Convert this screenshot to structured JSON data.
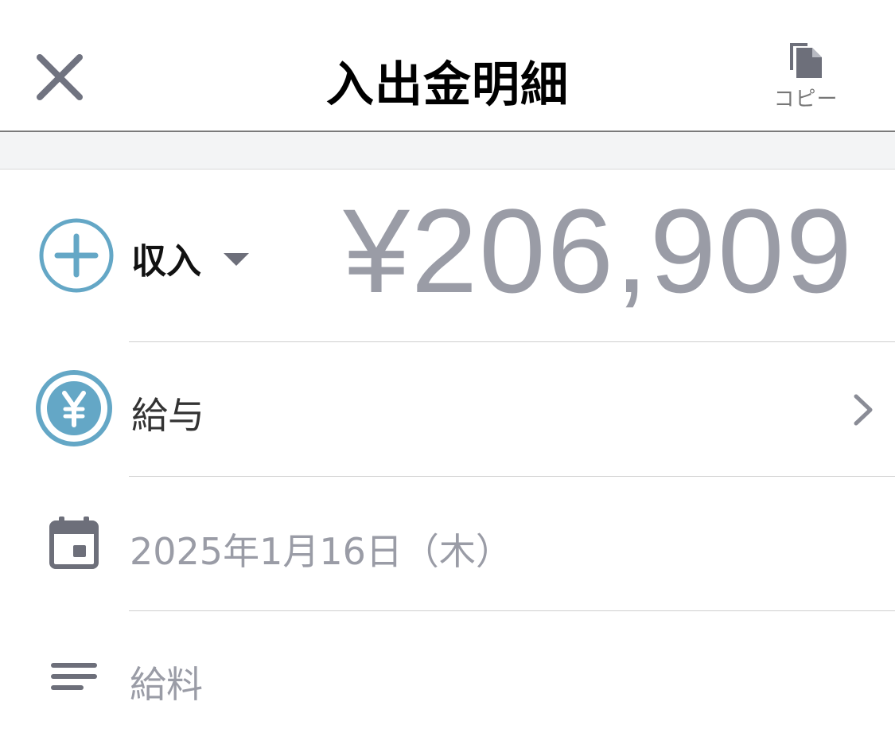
{
  "header": {
    "title": "入出金明細",
    "copy_label": "コピー"
  },
  "transaction": {
    "type_label": "収入",
    "amount": "¥206,909",
    "category": "給与",
    "date": "2025年1月16日（木）",
    "memo": "給料"
  },
  "icons": {
    "close": "close-icon",
    "copy": "copy-icon",
    "income_type": "plus-circle-icon",
    "category": "yen-circle-icon",
    "date": "calendar-icon",
    "memo": "memo-lines-icon",
    "chevron": "chevron-right-icon"
  },
  "colors": {
    "accent_blue": "#64a7c6",
    "amount_gray": "#9a9ca6",
    "icon_gray": "#6d6f7a"
  }
}
